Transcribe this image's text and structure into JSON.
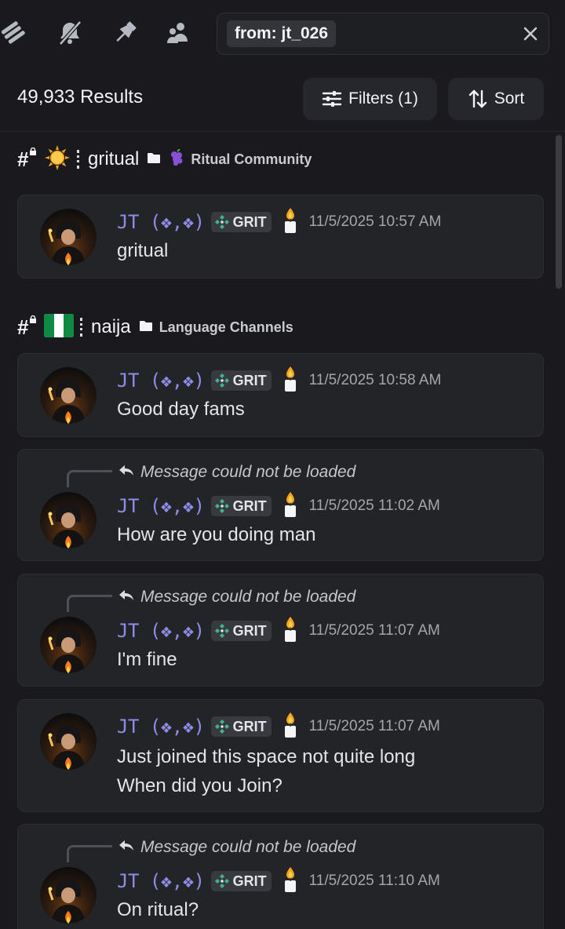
{
  "toolbar": {
    "icons": [
      "threads-icon",
      "mute-bell-icon",
      "pin-icon",
      "members-icon"
    ],
    "search": {
      "token": "from: jt_026"
    }
  },
  "results": {
    "count": "49,933 Results",
    "filters_label": "Filters (1)",
    "sort_label": "Sort"
  },
  "groups": [
    {
      "channel": {
        "emoji": "sun-emoji",
        "name": "gritual",
        "category": "Ritual Community"
      },
      "messages": [
        {
          "author": "JT (❖,❖)",
          "tag": "GRIT",
          "timestamp": "11/5/2025 10:57 AM",
          "lines": [
            "gritual"
          ]
        }
      ]
    },
    {
      "channel": {
        "emoji": "nigeria-flag-emoji",
        "name": "naija",
        "category": "Language Channels"
      },
      "messages": [
        {
          "author": "JT (❖,❖)",
          "tag": "GRIT",
          "timestamp": "11/5/2025 10:58 AM",
          "lines": [
            "Good day fams"
          ]
        },
        {
          "reply": "Message could not be loaded",
          "author": "JT (❖,❖)",
          "tag": "GRIT",
          "timestamp": "11/5/2025 11:02 AM",
          "lines": [
            "How are you doing man"
          ]
        },
        {
          "reply": "Message could not be loaded",
          "author": "JT (❖,❖)",
          "tag": "GRIT",
          "timestamp": "11/5/2025 11:07 AM",
          "lines": [
            "I'm fine"
          ]
        },
        {
          "author": "JT (❖,❖)",
          "tag": "GRIT",
          "timestamp": "11/5/2025 11:07 AM",
          "lines": [
            "Just joined this space not quite long",
            "When did you Join?"
          ]
        },
        {
          "reply": "Message could not be loaded",
          "author": "JT (❖,❖)",
          "tag": "GRIT",
          "timestamp": "11/5/2025 11:10 AM",
          "lines": [
            "On ritual?"
          ]
        }
      ]
    }
  ],
  "colors": {
    "background": "#1a1a1e",
    "card": "#232428",
    "author": "#8f8ce8",
    "tag_icon": "#3fb58a",
    "timestamp": "#a3a6aa"
  }
}
